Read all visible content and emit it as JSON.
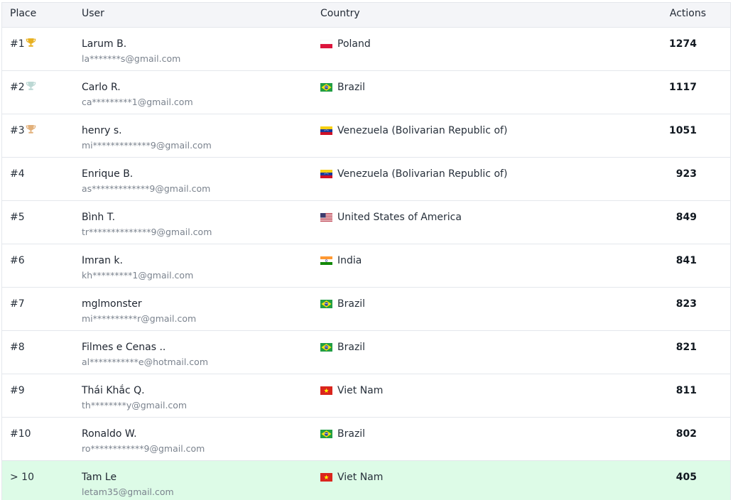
{
  "headers": {
    "place": "Place",
    "user": "User",
    "country": "Country",
    "actions": "Actions"
  },
  "rows": [
    {
      "place": "#1",
      "trophy": "gold",
      "name": "Larum B.",
      "email": "la*******s@gmail.com",
      "country": "Poland",
      "flag": "poland",
      "actions": "1274"
    },
    {
      "place": "#2",
      "trophy": "silver",
      "name": "Carlo R.",
      "email": "ca*********1@gmail.com",
      "country": "Brazil",
      "flag": "brazil",
      "actions": "1117"
    },
    {
      "place": "#3",
      "trophy": "bronze",
      "name": "henry s.",
      "email": "mi*************9@gmail.com",
      "country": "Venezuela (Bolivarian Republic of)",
      "flag": "venezuela",
      "actions": "1051"
    },
    {
      "place": "#4",
      "name": "Enrique B.",
      "email": "as*************9@gmail.com",
      "country": "Venezuela (Bolivarian Republic of)",
      "flag": "venezuela",
      "actions": "923"
    },
    {
      "place": "#5",
      "name": "Bình T.",
      "email": "tr**************9@gmail.com",
      "country": "United States of America",
      "flag": "usa",
      "actions": "849"
    },
    {
      "place": "#6",
      "name": "Imran k.",
      "email": "kh*********1@gmail.com",
      "country": "India",
      "flag": "india",
      "actions": "841"
    },
    {
      "place": "#7",
      "name": "mglmonster",
      "email": "mi**********r@gmail.com",
      "country": "Brazil",
      "flag": "brazil",
      "actions": "823"
    },
    {
      "place": "#8",
      "name": "Filmes e Cenas ..",
      "email": "al***********e@hotmail.com",
      "country": "Brazil",
      "flag": "brazil",
      "actions": "821"
    },
    {
      "place": "#9",
      "name": "Thái Khắc Q.",
      "email": "th********y@gmail.com",
      "country": "Viet Nam",
      "flag": "vietnam",
      "actions": "811"
    },
    {
      "place": "#10",
      "name": "Ronaldo W.",
      "email": "ro************9@gmail.com",
      "country": "Brazil",
      "flag": "brazil",
      "actions": "802"
    },
    {
      "place": "> 10",
      "name": "Tam Le",
      "email": "letam35@gmail.com",
      "country": "Viet Nam",
      "flag": "vietnam",
      "actions": "405",
      "highlight": true
    }
  ],
  "colors": {
    "gold": "#e8b020",
    "silver": "#bcd8d4",
    "bronze": "#e2b07a",
    "highlight": "#ddfbe7"
  }
}
